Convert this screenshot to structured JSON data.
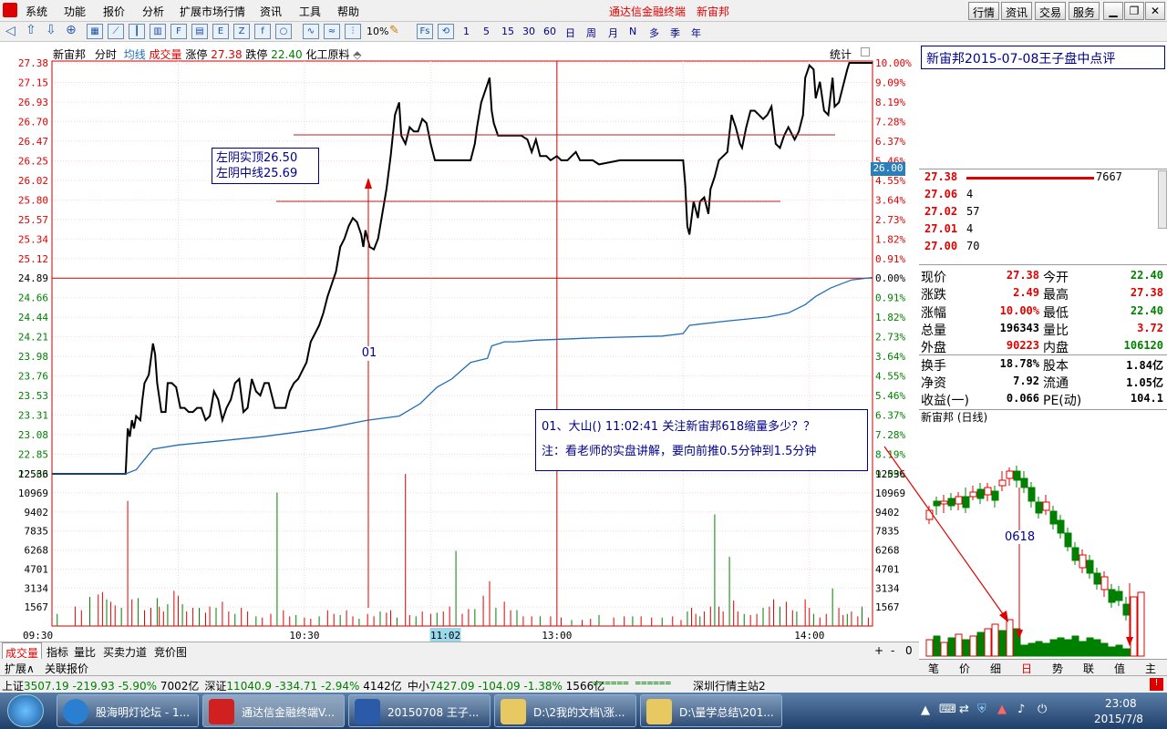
{
  "menu": {
    "items": [
      "系统",
      "功能",
      "报价",
      "分析",
      "扩展市场行情",
      "资讯",
      "工具",
      "帮助"
    ],
    "app_name": "通达信金融终端",
    "stock_name": "新宙邦"
  },
  "top_buttons": [
    "行情",
    "资讯",
    "交易",
    "服务"
  ],
  "toolbar": {
    "labels": [
      "1",
      "5",
      "15",
      "30",
      "60",
      "日",
      "周",
      "月",
      "N",
      "多",
      "季",
      "年"
    ],
    "pct_label": "10%"
  },
  "chart_header": {
    "name": "新宙邦",
    "mode": "分时",
    "avg_label": "均线",
    "vol_label": "成交量",
    "limit_up_label": "涨停",
    "limit_up": "27.38",
    "limit_down_label": "跌停",
    "limit_down": "22.40",
    "sector": "化工原料",
    "stats_label": "统计"
  },
  "colors": {
    "up": "#e00000",
    "down": "#008000",
    "line": "#000000",
    "avg": "#1e6eb8",
    "annot": "#00008b"
  },
  "chart_data": {
    "type": "line",
    "title": "",
    "x_ticks": [
      "09:30",
      "10:30",
      "11:02",
      "13:00",
      "14:00"
    ],
    "price_ticks": [
      "27.38",
      "27.15",
      "26.93",
      "26.70",
      "26.47",
      "26.25",
      "26.02",
      "25.80",
      "25.57",
      "25.34",
      "25.12",
      "24.89",
      "24.66",
      "24.44",
      "24.21",
      "23.98",
      "23.76",
      "23.53",
      "23.31",
      "23.08",
      "22.85",
      "22.63"
    ],
    "pct_ticks": [
      "10.00%",
      "9.09%",
      "8.19%",
      "7.28%",
      "6.37%",
      "5.46%",
      "4.55%",
      "3.64%",
      "2.73%",
      "1.82%",
      "0.91%",
      "0.00%",
      "0.91%",
      "1.82%",
      "2.73%",
      "3.64%",
      "4.55%",
      "5.46%",
      "6.37%",
      "7.28%",
      "8.19%",
      "9.09%"
    ],
    "vol_ticks": [
      "12536",
      "10969",
      "9402",
      "7835",
      "6268",
      "4701",
      "3134",
      "1567"
    ],
    "ylim": [
      22.4,
      27.38
    ],
    "current_price_flag": "26.00",
    "series": [],
    "price": [
      [
        0,
        22.4
      ],
      [
        70,
        22.4
      ],
      [
        72,
        22.95
      ],
      [
        74,
        22.85
      ],
      [
        76,
        23.05
      ],
      [
        78,
        22.95
      ],
      [
        80,
        23.1
      ],
      [
        84,
        23.05
      ],
      [
        86,
        23.3
      ],
      [
        88,
        23.5
      ],
      [
        92,
        23.6
      ],
      [
        96,
        23.98
      ],
      [
        98,
        23.85
      ],
      [
        100,
        23.5
      ],
      [
        104,
        23.15
      ],
      [
        108,
        23.15
      ],
      [
        110,
        23.5
      ],
      [
        114,
        23.5
      ],
      [
        118,
        23.45
      ],
      [
        122,
        23.2
      ],
      [
        126,
        23.2
      ],
      [
        130,
        23.15
      ],
      [
        134,
        23.15
      ],
      [
        138,
        23.2
      ],
      [
        142,
        23.2
      ],
      [
        146,
        23.05
      ],
      [
        150,
        23.1
      ],
      [
        154,
        23.4
      ],
      [
        158,
        23.3
      ],
      [
        162,
        23.05
      ],
      [
        166,
        23.2
      ],
      [
        170,
        23.3
      ],
      [
        174,
        23.5
      ],
      [
        178,
        23.55
      ],
      [
        182,
        23.15
      ],
      [
        186,
        23.2
      ],
      [
        190,
        23.55
      ],
      [
        194,
        23.4
      ],
      [
        198,
        23.35
      ],
      [
        202,
        23.5
      ],
      [
        206,
        23.5
      ],
      [
        212,
        23.2
      ],
      [
        216,
        23.2
      ],
      [
        222,
        23.2
      ],
      [
        226,
        23.4
      ],
      [
        230,
        23.5
      ],
      [
        234,
        23.55
      ],
      [
        238,
        23.65
      ],
      [
        242,
        23.75
      ],
      [
        246,
        24.0
      ],
      [
        250,
        24.1
      ],
      [
        254,
        24.2
      ],
      [
        258,
        24.35
      ],
      [
        262,
        24.55
      ],
      [
        266,
        24.7
      ],
      [
        270,
        24.85
      ],
      [
        274,
        25.15
      ],
      [
        278,
        25.25
      ],
      [
        282,
        25.4
      ],
      [
        286,
        25.5
      ],
      [
        290,
        25.45
      ],
      [
        294,
        25.3
      ],
      [
        296,
        25.15
      ],
      [
        298,
        25.35
      ],
      [
        302,
        25.15
      ],
      [
        306,
        25.12
      ],
      [
        310,
        25.25
      ],
      [
        314,
        25.55
      ],
      [
        318,
        25.85
      ],
      [
        322,
        26.25
      ],
      [
        326,
        26.75
      ],
      [
        330,
        26.9
      ],
      [
        332,
        26.5
      ],
      [
        336,
        26.4
      ],
      [
        340,
        26.6
      ],
      [
        344,
        26.55
      ],
      [
        348,
        26.55
      ],
      [
        352,
        26.7
      ],
      [
        356,
        26.65
      ],
      [
        360,
        26.4
      ],
      [
        364,
        26.2
      ],
      [
        368,
        26.2
      ],
      [
        380,
        26.2
      ],
      [
        390,
        26.2
      ],
      [
        398,
        26.2
      ],
      [
        402,
        26.4
      ],
      [
        404,
        26.6
      ],
      [
        408,
        26.9
      ],
      [
        412,
        27.05
      ],
      [
        416,
        27.2
      ],
      [
        418,
        26.8
      ],
      [
        420,
        26.65
      ],
      [
        424,
        26.5
      ],
      [
        430,
        26.5
      ],
      [
        440,
        26.5
      ],
      [
        446,
        26.5
      ],
      [
        452,
        26.45
      ],
      [
        456,
        26.3
      ],
      [
        460,
        26.45
      ],
      [
        464,
        26.25
      ],
      [
        470,
        26.25
      ],
      [
        474,
        26.2
      ],
      [
        480,
        26.25
      ],
      [
        484,
        26.2
      ],
      [
        490,
        26.2
      ],
      [
        494,
        26.25
      ],
      [
        498,
        26.3
      ],
      [
        502,
        26.2
      ],
      [
        508,
        26.2
      ],
      [
        514,
        26.2
      ],
      [
        520,
        26.15
      ],
      [
        540,
        26.2
      ],
      [
        560,
        26.2
      ],
      [
        580,
        26.2
      ],
      [
        600,
        26.2
      ],
      [
        602,
        25.9
      ],
      [
        604,
        25.4
      ],
      [
        606,
        25.3
      ],
      [
        610,
        25.7
      ],
      [
        614,
        25.5
      ],
      [
        616,
        25.7
      ],
      [
        620,
        25.75
      ],
      [
        624,
        25.55
      ],
      [
        626,
        25.85
      ],
      [
        630,
        26.0
      ],
      [
        634,
        26.2
      ],
      [
        638,
        26.25
      ],
      [
        642,
        26.3
      ],
      [
        646,
        26.75
      ],
      [
        650,
        26.6
      ],
      [
        654,
        26.4
      ],
      [
        656,
        26.35
      ],
      [
        660,
        26.6
      ],
      [
        664,
        26.8
      ],
      [
        668,
        26.8
      ],
      [
        672,
        26.75
      ],
      [
        676,
        26.7
      ],
      [
        680,
        26.75
      ],
      [
        684,
        26.85
      ],
      [
        688,
        26.4
      ],
      [
        692,
        26.35
      ],
      [
        696,
        26.5
      ],
      [
        700,
        26.6
      ],
      [
        704,
        26.5
      ],
      [
        706,
        26.45
      ],
      [
        710,
        26.55
      ],
      [
        714,
        26.75
      ],
      [
        716,
        27.2
      ],
      [
        720,
        27.35
      ],
      [
        724,
        27.3
      ],
      [
        726,
        26.95
      ],
      [
        730,
        27.15
      ],
      [
        734,
        26.8
      ],
      [
        738,
        26.75
      ],
      [
        742,
        27.2
      ],
      [
        744,
        26.85
      ],
      [
        748,
        26.9
      ],
      [
        752,
        27.1
      ],
      [
        756,
        27.3
      ],
      [
        758,
        27.38
      ],
      [
        780,
        27.38
      ]
    ],
    "avg": [
      [
        0,
        22.4
      ],
      [
        70,
        22.4
      ],
      [
        80,
        22.45
      ],
      [
        96,
        22.7
      ],
      [
        120,
        22.75
      ],
      [
        160,
        22.8
      ],
      [
        200,
        22.85
      ],
      [
        230,
        22.9
      ],
      [
        260,
        22.95
      ],
      [
        300,
        23.05
      ],
      [
        330,
        23.1
      ],
      [
        350,
        23.25
      ],
      [
        366,
        23.45
      ],
      [
        380,
        23.55
      ],
      [
        398,
        23.75
      ],
      [
        414,
        23.8
      ],
      [
        418,
        23.95
      ],
      [
        430,
        24.0
      ],
      [
        440,
        24.0
      ],
      [
        460,
        24.02
      ],
      [
        520,
        24.05
      ],
      [
        580,
        24.07
      ],
      [
        600,
        24.1
      ],
      [
        606,
        24.2
      ],
      [
        640,
        24.25
      ],
      [
        680,
        24.3
      ],
      [
        700,
        24.35
      ],
      [
        716,
        24.45
      ],
      [
        726,
        24.55
      ],
      [
        740,
        24.65
      ],
      [
        760,
        24.75
      ],
      [
        780,
        24.78
      ]
    ],
    "volume": [
      [
        5,
        1000
      ],
      [
        22,
        1600
      ],
      [
        28,
        1300
      ],
      [
        36,
        2400
      ],
      [
        44,
        2600
      ],
      [
        48,
        2800
      ],
      [
        52,
        2200
      ],
      [
        56,
        2000
      ],
      [
        60,
        1700
      ],
      [
        66,
        1500
      ],
      [
        72,
        10300
      ],
      [
        76,
        2200
      ],
      [
        82,
        2300
      ],
      [
        88,
        1300
      ],
      [
        94,
        1500
      ],
      [
        100,
        2300
      ],
      [
        102,
        1600
      ],
      [
        106,
        1200
      ],
      [
        110,
        1800
      ],
      [
        116,
        2900
      ],
      [
        120,
        2500
      ],
      [
        124,
        1800
      ],
      [
        128,
        1200
      ],
      [
        134,
        1500
      ],
      [
        140,
        1500
      ],
      [
        146,
        1100
      ],
      [
        150,
        1600
      ],
      [
        156,
        1500
      ],
      [
        162,
        2000
      ],
      [
        168,
        1200
      ],
      [
        174,
        1000
      ],
      [
        180,
        1500
      ],
      [
        186,
        1200
      ],
      [
        194,
        800
      ],
      [
        200,
        700
      ],
      [
        208,
        1000
      ],
      [
        214,
        11000
      ],
      [
        220,
        1300
      ],
      [
        226,
        800
      ],
      [
        232,
        900
      ],
      [
        240,
        700
      ],
      [
        246,
        600
      ],
      [
        254,
        800
      ],
      [
        262,
        1300
      ],
      [
        268,
        1000
      ],
      [
        274,
        900
      ],
      [
        280,
        1300
      ],
      [
        286,
        800
      ],
      [
        292,
        600
      ],
      [
        300,
        1000
      ],
      [
        306,
        800
      ],
      [
        312,
        1200
      ],
      [
        318,
        1100
      ],
      [
        322,
        1300
      ],
      [
        328,
        700
      ],
      [
        336,
        12536
      ],
      [
        340,
        900
      ],
      [
        346,
        800
      ],
      [
        352,
        1200
      ],
      [
        360,
        1000
      ],
      [
        366,
        1100
      ],
      [
        372,
        1200
      ],
      [
        378,
        1600
      ],
      [
        384,
        6200
      ],
      [
        390,
        1000
      ],
      [
        396,
        1400
      ],
      [
        402,
        1400
      ],
      [
        410,
        2500
      ],
      [
        416,
        3700
      ],
      [
        422,
        1500
      ],
      [
        430,
        2000
      ],
      [
        436,
        1300
      ],
      [
        442,
        1300
      ],
      [
        448,
        800
      ],
      [
        456,
        800
      ],
      [
        464,
        800
      ],
      [
        474,
        800
      ],
      [
        484,
        700
      ],
      [
        494,
        500
      ],
      [
        504,
        500
      ],
      [
        512,
        600
      ],
      [
        520,
        900
      ],
      [
        534,
        700
      ],
      [
        544,
        800
      ],
      [
        552,
        800
      ],
      [
        560,
        800
      ],
      [
        570,
        700
      ],
      [
        580,
        700
      ],
      [
        590,
        800
      ],
      [
        598,
        500
      ],
      [
        604,
        1200
      ],
      [
        608,
        1500
      ],
      [
        612,
        1000
      ],
      [
        616,
        800
      ],
      [
        620,
        1200
      ],
      [
        626,
        1600
      ],
      [
        630,
        9200
      ],
      [
        634,
        1600
      ],
      [
        638,
        1200
      ],
      [
        644,
        5700
      ],
      [
        648,
        2100
      ],
      [
        652,
        1200
      ],
      [
        658,
        1000
      ],
      [
        664,
        900
      ],
      [
        670,
        1000
      ],
      [
        676,
        1500
      ],
      [
        682,
        1600
      ],
      [
        686,
        2200
      ],
      [
        692,
        1600
      ],
      [
        698,
        2000
      ],
      [
        704,
        1300
      ],
      [
        708,
        1200
      ],
      [
        716,
        2200
      ],
      [
        720,
        1500
      ],
      [
        724,
        1000
      ],
      [
        730,
        700
      ],
      [
        736,
        1000
      ],
      [
        742,
        3100
      ],
      [
        748,
        1500
      ],
      [
        752,
        900
      ],
      [
        756,
        1000
      ],
      [
        760,
        1200
      ],
      [
        766,
        800
      ],
      [
        770,
        1600
      ],
      [
        776,
        700
      ]
    ]
  },
  "annotations": {
    "box1_line1": "左阴实顶26.50",
    "box1_line2": "左阴中线25.69",
    "arrow_label": "01",
    "box2_line1": "01、大山() 11:02:41  关注新宙邦618缩量多少？？",
    "box2_line2": "注：看老师的实盘讲解，要向前推0.5分钟到1.5分钟"
  },
  "bottom_tabs": [
    "成交量",
    "指标",
    "量比",
    "买卖力道",
    "竞价图"
  ],
  "bottom_tabs2": [
    "扩展∧",
    "关联报价"
  ],
  "bottom_ctrl": [
    "+",
    "-",
    "0"
  ],
  "right_panel": {
    "title": "新宙邦2015-07-08王子盘中点评",
    "orders": [
      {
        "price": "27.38",
        "qty": "7667"
      },
      {
        "price": "27.06",
        "qty": "4"
      },
      {
        "price": "27.02",
        "qty": "57"
      },
      {
        "price": "27.01",
        "qty": "4"
      },
      {
        "price": "27.00",
        "qty": "70"
      }
    ],
    "quote": [
      {
        "l1": "现价",
        "v1": "27.38",
        "l2": "今开",
        "v2": "22.40",
        "c1": "up",
        "c2": "down"
      },
      {
        "l1": "涨跌",
        "v1": "2.49",
        "l2": "最高",
        "v2": "27.38",
        "c1": "up",
        "c2": "up"
      },
      {
        "l1": "涨幅",
        "v1": "10.00%",
        "l2": "最低",
        "v2": "22.40",
        "c1": "up",
        "c2": "down"
      },
      {
        "l1": "总量",
        "v1": "196343",
        "l2": "量比",
        "v2": "3.72",
        "c1": "blk",
        "c2": "up"
      },
      {
        "l1": "外盘",
        "v1": "90223",
        "l2": "内盘",
        "v2": "106120",
        "c1": "up",
        "c2": "down"
      },
      {
        "l1": "换手",
        "v1": "18.78%",
        "l2": "股本",
        "v2": "1.84亿",
        "c1": "blk",
        "c2": "blk"
      },
      {
        "l1": "净资",
        "v1": "7.92",
        "l2": "流通",
        "v2": "1.05亿",
        "c1": "blk",
        "c2": "blk"
      },
      {
        "l1": "收益(一)",
        "v1": "0.066",
        "l2": "PE(动)",
        "v2": "104.1",
        "c1": "blk",
        "c2": "blk"
      }
    ],
    "kline_title": "新宙邦 (日线)",
    "kline_label": "0618",
    "kline_tabs": [
      "笔",
      "价",
      "细",
      "日",
      "势",
      "联",
      "值",
      "主"
    ]
  },
  "status": [
    {
      "name": "上证",
      "val": "3507.19",
      "chg": "-219.93",
      "pct": "-5.90%",
      "amt": "7002亿"
    },
    {
      "name": "深证",
      "val": "11040.9",
      "chg": "-334.71",
      "pct": "-2.94%",
      "amt": "4142亿"
    },
    {
      "name": "中小",
      "val": "7427.09",
      "chg": "-104.09",
      "pct": "-1.38%",
      "amt": "1566亿"
    }
  ],
  "status_bars": "====== ======",
  "status_server": "深圳行情主站2",
  "taskbar": {
    "items": [
      "股海明灯论坛 - 1...",
      "通达信金融终端V...",
      "20150708 王子...",
      "D:\\2我的文档\\涨...",
      "D:\\量学总结\\201..."
    ],
    "time": "23:08",
    "date": "2015/7/8"
  }
}
